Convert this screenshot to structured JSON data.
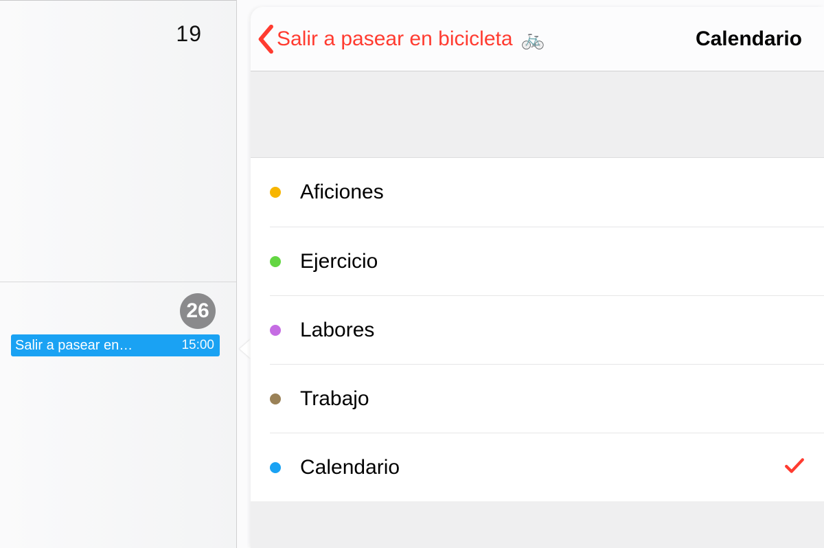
{
  "month_col": {
    "days": [
      {
        "number": "19",
        "today": false
      },
      {
        "number": "26",
        "today": true,
        "event": {
          "title": "Salir a pasear en…",
          "time": "15:00"
        }
      }
    ]
  },
  "popover": {
    "back_label": "Salir a pasear en bicicleta",
    "back_emoji": "🚲",
    "title": "Calendario",
    "calendars": [
      {
        "label": "Aficiones",
        "color": "#f7b500",
        "selected": false
      },
      {
        "label": "Ejercicio",
        "color": "#63d642",
        "selected": false
      },
      {
        "label": "Labores",
        "color": "#c56ce3",
        "selected": false
      },
      {
        "label": "Trabajo",
        "color": "#9a8157",
        "selected": false
      },
      {
        "label": "Calendario",
        "color": "#1aa2f3",
        "selected": true
      }
    ]
  }
}
